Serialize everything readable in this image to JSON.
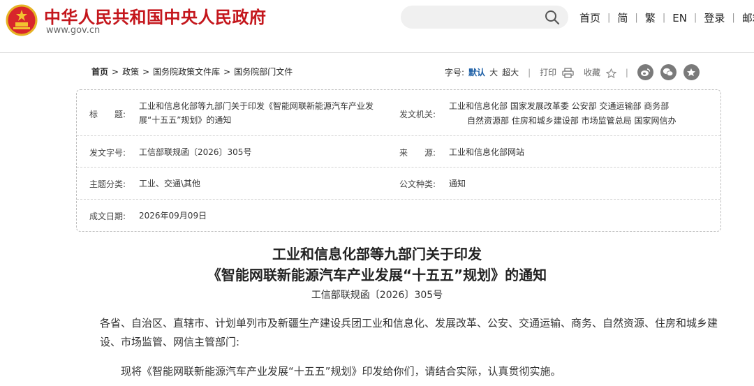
{
  "header": {
    "site_name": "中华人民共和国中央人民政府",
    "site_url": "www.gov.cn",
    "nav": [
      "首页",
      "简",
      "繁",
      "EN",
      "登录",
      "邮箱"
    ]
  },
  "breadcrumb": {
    "items": [
      "首页",
      "政策",
      "国务院政策文件库",
      "国务院部门文件"
    ]
  },
  "toolbar": {
    "font_size_label": "字号:",
    "sizes": [
      "默认",
      "大",
      "超大"
    ],
    "print_label": "打印",
    "favorite_label": "收藏"
  },
  "info": {
    "title_label": "标　　题:",
    "title_value": "工业和信息化部等九部门关于印发《智能网联新能源汽车产业发展“十五五”规划》的通知",
    "issuer_label": "发文机关:",
    "issuer_line1": "工业和信息化部 国家发展改革委 公安部 交通运输部 商务部",
    "issuer_line2": "自然资源部 住房和城乡建设部 市场监管总局 国家网信办",
    "docno_label": "发文字号:",
    "docno_value": "工信部联规函〔2026〕305号",
    "source_label": "来　　源:",
    "source_value": "工业和信息化部网站",
    "topic_label": "主题分类:",
    "topic_value": "工业、交通\\其他",
    "doctype_label": "公文种类:",
    "doctype_value": "通知",
    "date_label": "成文日期:",
    "date_value": "2026年09月09日"
  },
  "article": {
    "title_line1": "工业和信息化部等九部门关于印发",
    "title_line2": "《智能网联新能源汽车产业发展“十五五”规划》的通知",
    "doc_number": "工信部联规函〔2026〕305号",
    "addressee": "各省、自治区、直辖市、计划单列市及新疆生产建设兵团工业和信息化、发展改革、公安、交通运输、商务、自然资源、住房和城乡建设、市场监管、网信主管部门:",
    "body1": "现将《智能网联新能源汽车产业发展“十五五”规划》印发给你们，请结合实际，认真贯彻实施。"
  },
  "colors": {
    "brand_red": "#c4161c",
    "link_blue": "#1d5fa6"
  },
  "icons": [
    "national-emblem-icon",
    "search-icon",
    "printer-icon",
    "star-icon",
    "weibo-icon",
    "wechat-icon",
    "share-icon"
  ]
}
